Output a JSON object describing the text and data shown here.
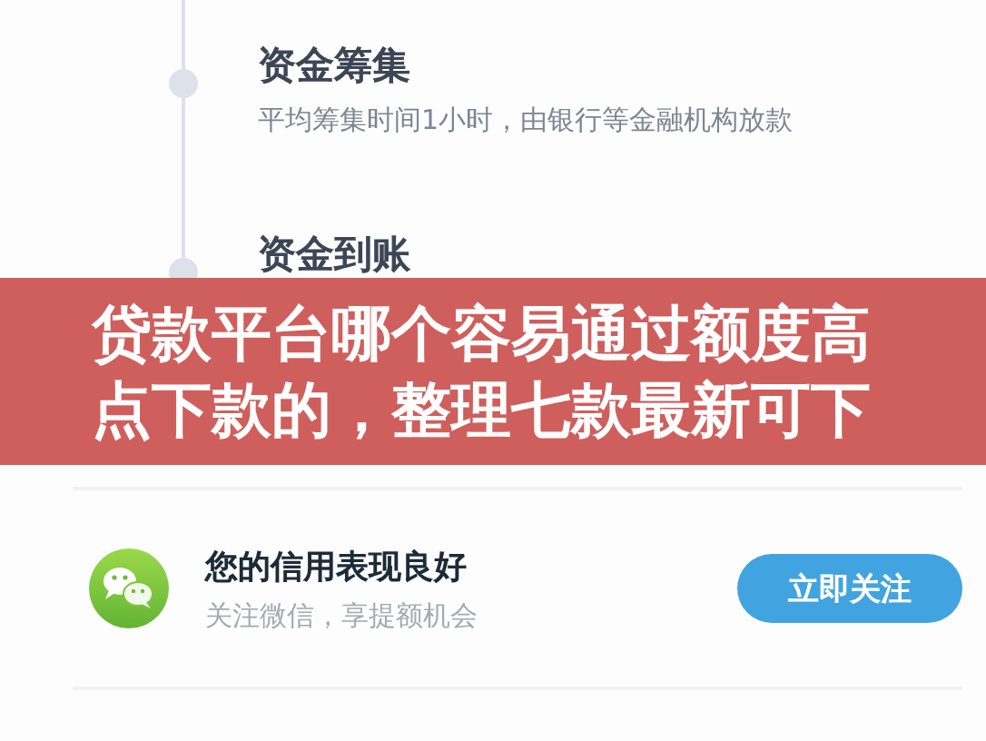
{
  "steps": [
    {
      "title": "资金筹集",
      "description": "平均筹集时间1小时，由银行等金融机构放款"
    },
    {
      "title": "资金到账"
    }
  ],
  "banner": {
    "title": "贷款平台哪个容易通过额度高点下款的，整理七款最新可下"
  },
  "promo": {
    "title": "您的信用表现良好",
    "subtitle": "关注微信，享提额机会",
    "button": "立即关注"
  }
}
